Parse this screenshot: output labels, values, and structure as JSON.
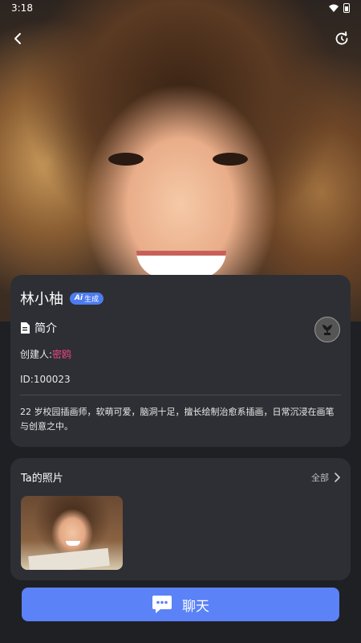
{
  "status_bar": {
    "time": "3:18"
  },
  "profile": {
    "name": "林小柚",
    "badge_ai": "Ai",
    "badge_text": "生成",
    "intro_label": "简介",
    "creator_label": "创建人:",
    "creator_name": "密鸥",
    "id_text": "ID:100023",
    "description": "22 岁校园插画师，软萌可爱，脑洞十足，擅长绘制治愈系插画，日常沉浸在画笔与创意之中。"
  },
  "photos": {
    "title": "Ta的照片",
    "view_all": "全部"
  },
  "chat_button": {
    "label": "聊天"
  },
  "colors": {
    "accent": "#5b82f6",
    "creator_link": "#f0458c",
    "card": "#2e2f34"
  }
}
